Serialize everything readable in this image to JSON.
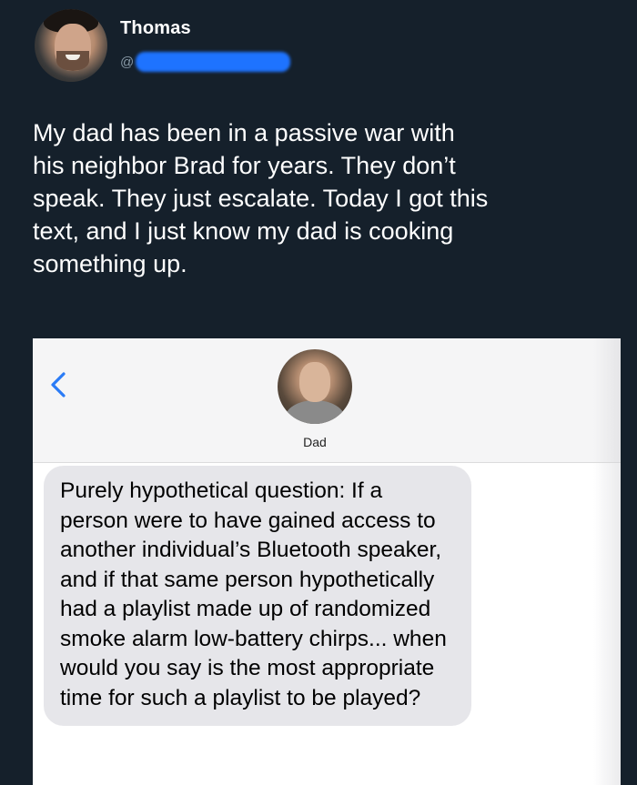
{
  "tweet": {
    "author_name": "Thomas",
    "handle_prefix": "@",
    "text": "My dad has been in a passive war with\nhis neighbor Brad for years. They don’t\nspeak. They just escalate. Today I got this\ntext, and I just know my dad is cooking\nsomething up."
  },
  "colors": {
    "background": "#15202b",
    "handle_redaction": "#1e73ff",
    "bubble": "#e6e6ea"
  },
  "imessage": {
    "back_icon": "chevron-left-icon",
    "contact_name": "Dad",
    "message": "Purely hypothetical question: If a person were to have gained access to another individual’s Bluetooth speaker, and if that same person hypothetically had a playlist made up of randomized smoke alarm low-battery chirps... when would you say is the most appropriate time for such a playlist to be played?"
  }
}
